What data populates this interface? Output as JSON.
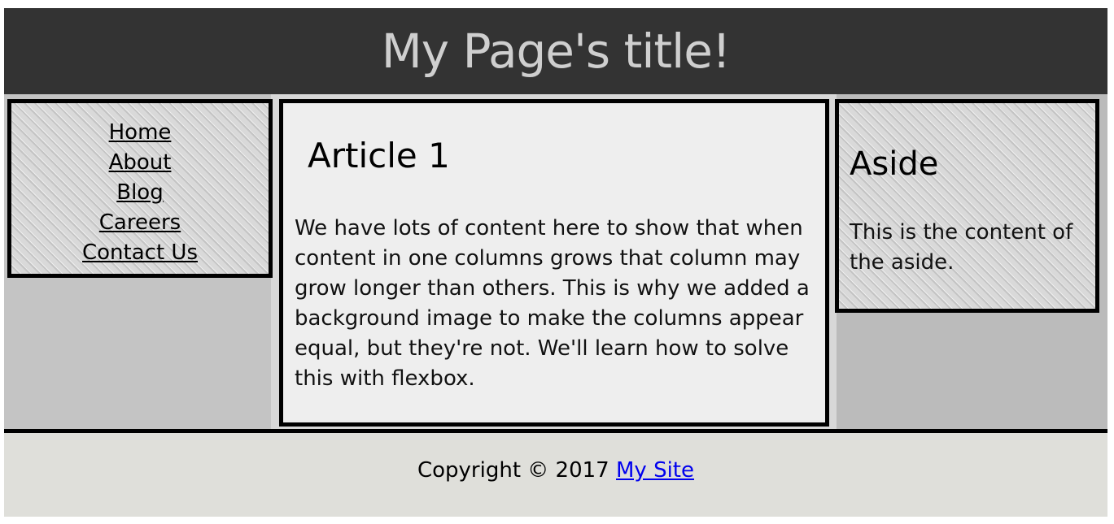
{
  "header": {
    "title": "My Page's title!"
  },
  "nav": {
    "items": [
      {
        "label": "Home"
      },
      {
        "label": "About"
      },
      {
        "label": "Blog"
      },
      {
        "label": "Careers"
      },
      {
        "label": "Contact Us"
      }
    ]
  },
  "article": {
    "heading": "Article 1",
    "body": "We have lots of content here to show that when content in one columns grows that column may grow longer than others. This is why we added a background image to make the columns appear equal, but they're not. We'll learn how to solve this with flexbox."
  },
  "aside": {
    "heading": "Aside",
    "body": "This is the content of the aside."
  },
  "footer": {
    "copyright_text": "Copyright © 2017 ",
    "link_label": "My Site"
  },
  "colors": {
    "header_bg": "#333333",
    "header_text": "#cfcfcf",
    "article_bg": "#eeeeee",
    "footer_bg": "#dfdfda",
    "link": "#0000ee"
  }
}
